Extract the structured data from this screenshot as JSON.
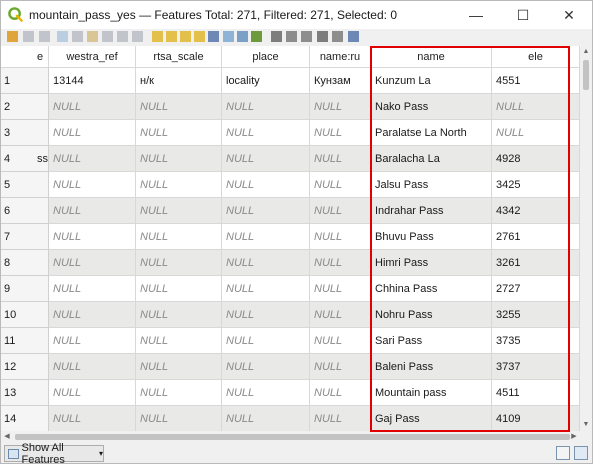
{
  "window": {
    "title": "mountain_pass_yes — Features Total: 271, Filtered: 271, Selected: 0",
    "min_glyph": "—",
    "max_glyph": "☐",
    "close_glyph": "✕"
  },
  "toolbar": {
    "icons": [
      "pencil-icon",
      "toggle-multi-edit-icon",
      "save-edits-icon",
      "reload-icon",
      "add-feature-icon",
      "delete-feature-icon",
      "cut-icon",
      "copy-icon",
      "paste-icon",
      "select-by-expression-icon",
      "select-all-icon",
      "invert-selection-icon",
      "deselect-icon",
      "filter-select-icon",
      "move-selection-top-icon",
      "pan-to-selection-icon",
      "zoom-to-selection-icon",
      "new-field-icon",
      "delete-field-icon",
      "field-calculator-icon",
      "conditional-format-icon",
      "actions-icon",
      "dock-icon"
    ]
  },
  "table": {
    "columns": [
      {
        "key": "prev",
        "label": "e"
      },
      {
        "key": "westra_ref",
        "label": "westra_ref"
      },
      {
        "key": "rtsa_scale",
        "label": "rtsa_scale"
      },
      {
        "key": "place",
        "label": "place"
      },
      {
        "key": "name_ru",
        "label": "name:ru"
      },
      {
        "key": "name",
        "label": "name"
      },
      {
        "key": "ele",
        "label": "ele"
      }
    ],
    "rows": [
      {
        "num": "1",
        "prev": "",
        "westra_ref": "13144",
        "rtsa_scale": "н/к",
        "place": "locality",
        "name_ru": "Кунзам",
        "name": "Kunzum La",
        "ele": "4551"
      },
      {
        "num": "2",
        "prev": "",
        "westra_ref": "NULL",
        "rtsa_scale": "NULL",
        "place": "NULL",
        "name_ru": "NULL",
        "name": "Nako Pass",
        "ele": "NULL"
      },
      {
        "num": "3",
        "prev": "",
        "westra_ref": "NULL",
        "rtsa_scale": "NULL",
        "place": "NULL",
        "name_ru": "NULL",
        "name": "Paralatse La North",
        "ele": "NULL"
      },
      {
        "num": "4",
        "prev": "ss",
        "westra_ref": "NULL",
        "rtsa_scale": "NULL",
        "place": "NULL",
        "name_ru": "NULL",
        "name": "Baralacha La",
        "ele": "4928"
      },
      {
        "num": "5",
        "prev": "",
        "westra_ref": "NULL",
        "rtsa_scale": "NULL",
        "place": "NULL",
        "name_ru": "NULL",
        "name": "Jalsu Pass",
        "ele": "3425"
      },
      {
        "num": "6",
        "prev": "",
        "westra_ref": "NULL",
        "rtsa_scale": "NULL",
        "place": "NULL",
        "name_ru": "NULL",
        "name": "Indrahar Pass",
        "ele": "4342"
      },
      {
        "num": "7",
        "prev": "",
        "westra_ref": "NULL",
        "rtsa_scale": "NULL",
        "place": "NULL",
        "name_ru": "NULL",
        "name": "Bhuvu Pass",
        "ele": "2761"
      },
      {
        "num": "8",
        "prev": "",
        "westra_ref": "NULL",
        "rtsa_scale": "NULL",
        "place": "NULL",
        "name_ru": "NULL",
        "name": "Himri Pass",
        "ele": "3261"
      },
      {
        "num": "9",
        "prev": "",
        "westra_ref": "NULL",
        "rtsa_scale": "NULL",
        "place": "NULL",
        "name_ru": "NULL",
        "name": "Chhina Pass",
        "ele": "2727"
      },
      {
        "num": "10",
        "prev": "",
        "westra_ref": "NULL",
        "rtsa_scale": "NULL",
        "place": "NULL",
        "name_ru": "NULL",
        "name": "Nohru Pass",
        "ele": "3255"
      },
      {
        "num": "11",
        "prev": "",
        "westra_ref": "NULL",
        "rtsa_scale": "NULL",
        "place": "NULL",
        "name_ru": "NULL",
        "name": "Sari Pass",
        "ele": "3735"
      },
      {
        "num": "12",
        "prev": "",
        "westra_ref": "NULL",
        "rtsa_scale": "NULL",
        "place": "NULL",
        "name_ru": "NULL",
        "name": "Baleni Pass",
        "ele": "3737"
      },
      {
        "num": "13",
        "prev": "",
        "westra_ref": "NULL",
        "rtsa_scale": "NULL",
        "place": "NULL",
        "name_ru": "NULL",
        "name": "Mountain pass",
        "ele": "4511"
      },
      {
        "num": "14",
        "prev": "",
        "westra_ref": "NULL",
        "rtsa_scale": "NULL",
        "place": "NULL",
        "name_ru": "NULL",
        "name": "Gaj Pass",
        "ele": "4109"
      }
    ]
  },
  "bottom": {
    "filter_label": "Show All Features",
    "caret": "▾"
  },
  "colors": {
    "highlight": "#e00000",
    "null_text": "#8a8a8a",
    "alt_row": "#e9e9e7"
  }
}
